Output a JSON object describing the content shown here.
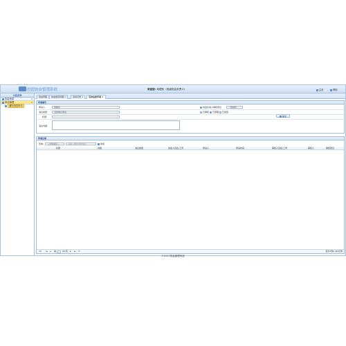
{
  "header": {
    "app_title": "校园协会管理系统",
    "user_label": "欢迎您:",
    "user_name": "地理系（班级协会负责人）",
    "home_label": "主页",
    "help_label": "帮助"
  },
  "sidebar": {
    "title": "功能菜单",
    "groups": [
      {
        "label": "协会信息"
      },
      {
        "label": "申请管理",
        "selected": true
      }
    ],
    "items": [
      {
        "label": "通知消息申请"
      }
    ]
  },
  "tabs": [
    {
      "label": "欢迎界面"
    },
    {
      "label": "协会成员管理"
    },
    {
      "label": "活动记录"
    },
    {
      "label": "活动信息申请",
      "active": true
    }
  ],
  "form": {
    "title": "申请填写",
    "fields": {
      "applicant_label": "申请人:",
      "applicant_value": "地理系",
      "type_label": "消息类型:",
      "type_value": "活动信息申请",
      "title_label": "标题:",
      "title_value": "",
      "content_label": "消息内容:",
      "content_value": ""
    },
    "right": {
      "radio_label": "协会负责人审核意见",
      "select_value": "一级审核",
      "options": [
        "已审核",
        "已受理",
        "已驳回"
      ],
      "submit_label": "提交"
    }
  },
  "records": {
    "title": "申请记录",
    "filter_label": "查询:",
    "filter_select": "—全部消息—",
    "search_placeholder": "请输入要查询的信息",
    "search_button": "搜索",
    "columns": [
      "标题",
      "内容",
      "消息类型",
      "协会人员名/工号",
      "申请人",
      "申请时间",
      "审核人员名/工号",
      "审核人",
      "审核意见"
    ],
    "pager": {
      "page_size": "10",
      "page_label": "第",
      "page_of": "共1页",
      "summary": "显示0到0,共0记录"
    }
  },
  "footer": {
    "text": "©2023协会管理系统"
  }
}
